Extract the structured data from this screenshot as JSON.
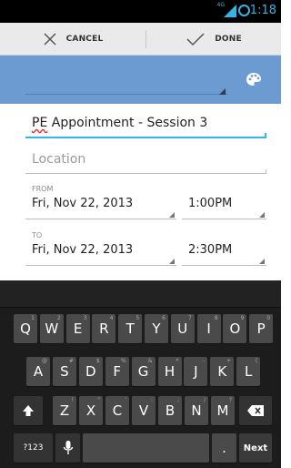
{
  "status_bar": {
    "network": "4G",
    "time": "1:18"
  },
  "action_bar": {
    "cancel_label": "CANCEL",
    "done_label": "DONE"
  },
  "calendar_color": "#6b9bd0",
  "form": {
    "title_prefix": "PE",
    "title_rest": " Appointment - Session 3",
    "location_placeholder": "Location",
    "from_label": "FROM",
    "from_date": "Fri, Nov 22, 2013",
    "from_time": "1:00PM",
    "to_label": "TO",
    "to_date": "Fri, Nov 22, 2013",
    "to_time": "2:30PM"
  },
  "keyboard": {
    "row1": [
      {
        "k": "Q",
        "h": "1"
      },
      {
        "k": "W",
        "h": "2"
      },
      {
        "k": "E",
        "h": "3"
      },
      {
        "k": "R",
        "h": "4"
      },
      {
        "k": "T",
        "h": "5"
      },
      {
        "k": "Y",
        "h": "6"
      },
      {
        "k": "U",
        "h": "7"
      },
      {
        "k": "I",
        "h": "8"
      },
      {
        "k": "O",
        "h": "9"
      },
      {
        "k": "P",
        "h": "0"
      }
    ],
    "row2": [
      {
        "k": "A",
        "h": "@"
      },
      {
        "k": "S",
        "h": "#"
      },
      {
        "k": "D",
        "h": "$"
      },
      {
        "k": "F",
        "h": "%"
      },
      {
        "k": "G",
        "h": "&"
      },
      {
        "k": "H",
        "h": "*"
      },
      {
        "k": "J",
        "h": "-"
      },
      {
        "k": "K",
        "h": "+"
      },
      {
        "k": "L",
        "h": "("
      }
    ],
    "row3": [
      {
        "k": "Z",
        "h": "!"
      },
      {
        "k": "X",
        "h": "\""
      },
      {
        "k": "C",
        "h": "'"
      },
      {
        "k": "V",
        "h": ":"
      },
      {
        "k": "B",
        "h": ";"
      },
      {
        "k": "N",
        "h": "/"
      },
      {
        "k": "M",
        "h": "?"
      }
    ],
    "symbols_label": "?123",
    "period_label": ".",
    "next_label": "Next"
  }
}
